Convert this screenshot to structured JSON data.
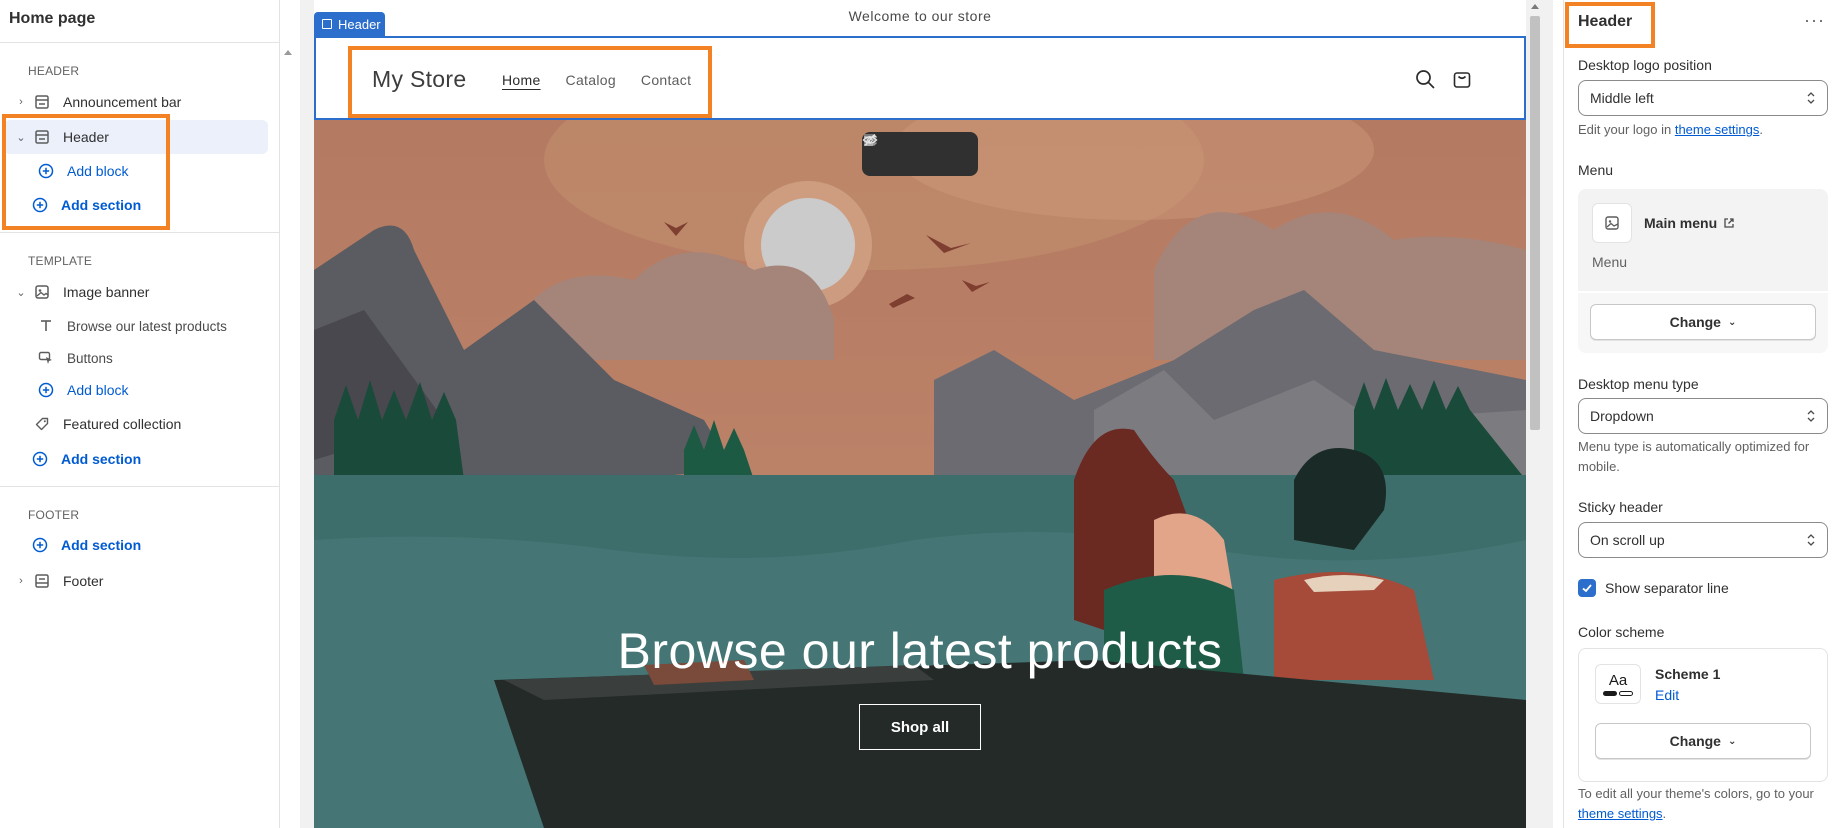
{
  "sidebar": {
    "title": "Home page",
    "header_group": "HEADER",
    "template_group": "TEMPLATE",
    "footer_group": "FOOTER",
    "items": {
      "announcement_bar": "Announcement bar",
      "header": "Header",
      "header_add_block": "Add block",
      "header_add_section": "Add section",
      "image_banner": "Image banner",
      "browse_text": "Browse our latest products",
      "buttons": "Buttons",
      "banner_add_block": "Add block",
      "featured_collection": "Featured collection",
      "template_add_section": "Add section",
      "footer_add_section": "Add section",
      "footer": "Footer"
    }
  },
  "preview": {
    "announcement": "Welcome to our store",
    "header_tag": "Header",
    "store_name": "My Store",
    "nav": [
      "Home",
      "Catalog",
      "Contact"
    ],
    "hero_title": "Browse our latest products",
    "hero_button": "Shop all"
  },
  "panel": {
    "title": "Header",
    "more": "···",
    "logo_position_label": "Desktop logo position",
    "logo_position_value": "Middle left",
    "logo_help_prefix": "Edit your logo in ",
    "logo_help_link": "theme settings",
    "logo_help_suffix": ".",
    "menu_label": "Menu",
    "menu_name": "Main menu",
    "menu_sub": "Menu",
    "menu_change": "Change",
    "menu_type_label": "Desktop menu type",
    "menu_type_value": "Dropdown",
    "menu_type_help": "Menu type is automatically optimized for mobile.",
    "sticky_label": "Sticky header",
    "sticky_value": "On scroll up",
    "separator_label": "Show separator line",
    "color_scheme_label": "Color scheme",
    "scheme_swatch": "Aa",
    "scheme_name": "Scheme 1",
    "scheme_edit": "Edit",
    "scheme_change": "Change",
    "colors_help_prefix": "To edit all your theme's colors, go to your ",
    "colors_help_link": "theme settings",
    "colors_help_suffix": "."
  },
  "colors": {
    "accent": "#005bd3",
    "selection": "#2c6ecb",
    "highlight": "#f28224"
  }
}
